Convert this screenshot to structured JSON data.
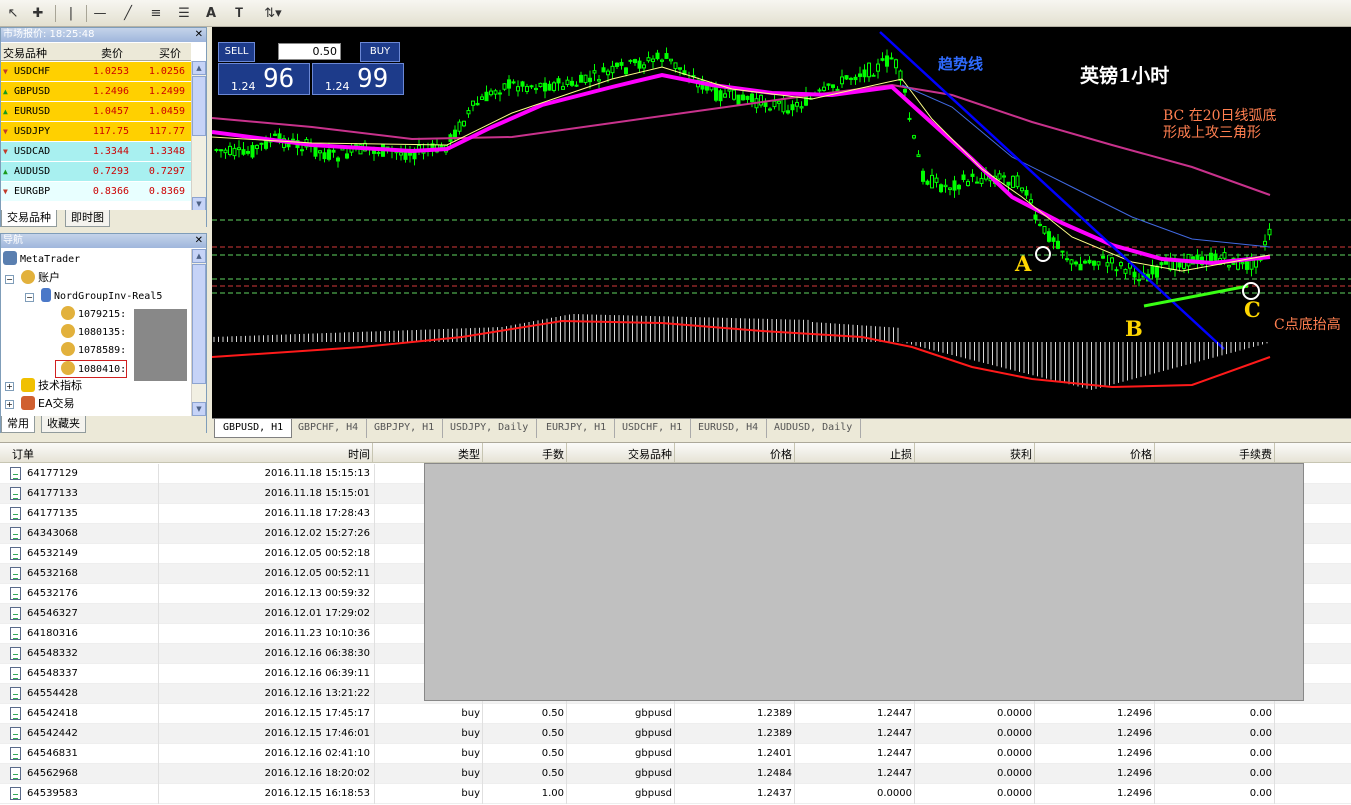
{
  "toolbar": {
    "items": [
      "cursor",
      "crosshair",
      "vertical-line",
      "horizontal-line",
      "trend-line",
      "fibonacci",
      "channels",
      "text",
      "text-label",
      "arrows"
    ],
    "text_tool_label": "A"
  },
  "market_watch": {
    "title": "市场报价: 18:25:48",
    "col_symbol": "交易品种",
    "col_bid": "卖价",
    "col_ask": "买价",
    "rows": [
      {
        "symbol": "USDCHF",
        "bid": "1.0253",
        "ask": "1.0256",
        "color": "#ffd000",
        "dir": "down"
      },
      {
        "symbol": "GBPUSD",
        "bid": "1.2496",
        "ask": "1.2499",
        "color": "#ffd000",
        "dir": "up"
      },
      {
        "symbol": "EURUSD",
        "bid": "1.0457",
        "ask": "1.0459",
        "color": "#ffd000",
        "dir": "up"
      },
      {
        "symbol": "USDJPY",
        "bid": "117.75",
        "ask": "117.77",
        "color": "#ffd000",
        "dir": "down"
      },
      {
        "symbol": "USDCAD",
        "bid": "1.3344",
        "ask": "1.3348",
        "color": "#a8f0f0",
        "dir": "down"
      },
      {
        "symbol": "AUDUSD",
        "bid": "0.7293",
        "ask": "0.7297",
        "color": "#a8f0f0",
        "dir": "up"
      },
      {
        "symbol": "EURGBP",
        "bid": "0.8366",
        "ask": "0.8369",
        "color": "#e8ffff",
        "dir": "down"
      }
    ],
    "tabs": [
      "交易品种",
      "即时图"
    ]
  },
  "navigator": {
    "title": "导航",
    "root": "MetaTrader",
    "accounts_label": "账户",
    "server": "NordGroupInv-Real5",
    "accounts": [
      "1079215:",
      "1080135:",
      "1078589:",
      "1080410:"
    ],
    "indicators": "技术指标",
    "ea": "EA交易",
    "tabs": [
      "常用",
      "收藏夹"
    ]
  },
  "chart": {
    "trade_panel": {
      "sell_label": "SELL",
      "buy_label": "BUY",
      "lots": "0.50",
      "bid_prefix": "1.24",
      "bid_big": "96",
      "ask_prefix": "1.24",
      "ask_big": "99"
    },
    "annotations": {
      "trendline_label": "趋势线",
      "title": "英镑1小时",
      "note_line1": "BC 在20日线弧底",
      "note_line2": "形成上攻三角形",
      "point_a": "A",
      "point_b": "B",
      "point_c": "C",
      "note_c": "C点底抬高"
    },
    "colors": {
      "bull": "#00ff00",
      "ma_thick": "#ff00ff",
      "ma_slow": "#c8328c",
      "ma_blue": "#4169e1",
      "trend": "#0000ff",
      "support": "#39ff14",
      "macd_signal": "#ff1a1a"
    }
  },
  "chart_tabs": [
    "GBPUSD, H1",
    "GBPCHF, H4",
    "GBPJPY, H1",
    "USDJPY, Daily",
    "EURJPY, H1",
    "USDCHF, H1",
    "EURUSD, H4",
    "AUDUSD, Daily"
  ],
  "grid": {
    "headers": [
      "订单",
      "时间",
      "类型",
      "手数",
      "交易品种",
      "价格",
      "止损",
      "获利",
      "价格",
      "手续费"
    ],
    "rows": [
      {
        "order": "64177129",
        "time": "2016.11.18 15:15:13"
      },
      {
        "order": "64177133",
        "time": "2016.11.18 15:15:01"
      },
      {
        "order": "64177135",
        "time": "2016.11.18 17:28:43"
      },
      {
        "order": "64343068",
        "time": "2016.12.02 15:27:26"
      },
      {
        "order": "64532149",
        "time": "2016.12.05 00:52:18"
      },
      {
        "order": "64532168",
        "time": "2016.12.05 00:52:11"
      },
      {
        "order": "64532176",
        "time": "2016.12.13 00:59:32"
      },
      {
        "order": "64546327",
        "time": "2016.12.01 17:29:02"
      },
      {
        "order": "64180316",
        "time": "2016.11.23 10:10:36"
      },
      {
        "order": "64548332",
        "time": "2016.12.16 06:38:30"
      },
      {
        "order": "64548337",
        "time": "2016.12.16 06:39:11"
      },
      {
        "order": "64554428",
        "time": "2016.12.16 13:21:22"
      },
      {
        "order": "64542418",
        "time": "2016.12.15 17:45:17",
        "type": "buy",
        "lots": "0.50",
        "symbol": "gbpusd",
        "price": "1.2389",
        "sl": "1.2447",
        "tp": "0.0000",
        "cur": "1.2496",
        "fee": "0.00"
      },
      {
        "order": "64542442",
        "time": "2016.12.15 17:46:01",
        "type": "buy",
        "lots": "0.50",
        "symbol": "gbpusd",
        "price": "1.2389",
        "sl": "1.2447",
        "tp": "0.0000",
        "cur": "1.2496",
        "fee": "0.00"
      },
      {
        "order": "64546831",
        "time": "2016.12.16 02:41:10",
        "type": "buy",
        "lots": "0.50",
        "symbol": "gbpusd",
        "price": "1.2401",
        "sl": "1.2447",
        "tp": "0.0000",
        "cur": "1.2496",
        "fee": "0.00"
      },
      {
        "order": "64562968",
        "time": "2016.12.16 18:20:02",
        "type": "buy",
        "lots": "0.50",
        "symbol": "gbpusd",
        "price": "1.2484",
        "sl": "1.2447",
        "tp": "0.0000",
        "cur": "1.2496",
        "fee": "0.00"
      },
      {
        "order": "64539583",
        "time": "2016.12.15 16:18:53",
        "type": "buy",
        "lots": "1.00",
        "symbol": "gbpusd",
        "price": "1.2437",
        "sl": "0.0000",
        "tp": "0.0000",
        "cur": "1.2496",
        "fee": "0.00"
      }
    ]
  }
}
